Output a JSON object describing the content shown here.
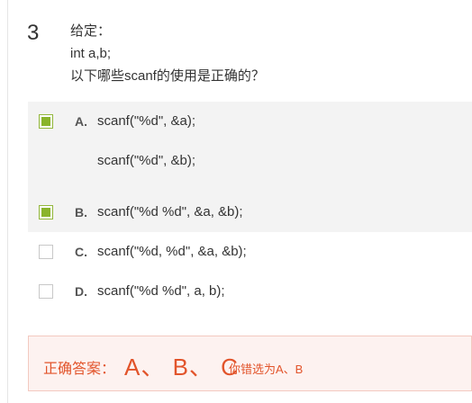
{
  "question": {
    "number": "3",
    "stem_lines": [
      "给定：",
      "int a,b;",
      "以下哪些scanf的使用是正确的？"
    ]
  },
  "options": [
    {
      "letter": "A.",
      "lines": [
        "scanf(\"%d\", &a);",
        "scanf(\"%d\", &b);"
      ],
      "checked": true
    },
    {
      "letter": "B.",
      "lines": [
        "scanf(\"%d %d\", &a, &b);"
      ],
      "checked": true
    },
    {
      "letter": "C.",
      "lines": [
        "scanf(\"%d, %d\", &a, &b);"
      ],
      "checked": false
    },
    {
      "letter": "D.",
      "lines": [
        "scanf(\"%d %d\", a, b);"
      ],
      "checked": false
    }
  ],
  "answer": {
    "label": "正确答案：",
    "value": "A、 B、 C",
    "your_choice": "你错选为A、B"
  },
  "colors": {
    "accent_green": "#8ab42b",
    "answer_red": "#e2542b",
    "answer_bg": "#fdf2f0"
  }
}
